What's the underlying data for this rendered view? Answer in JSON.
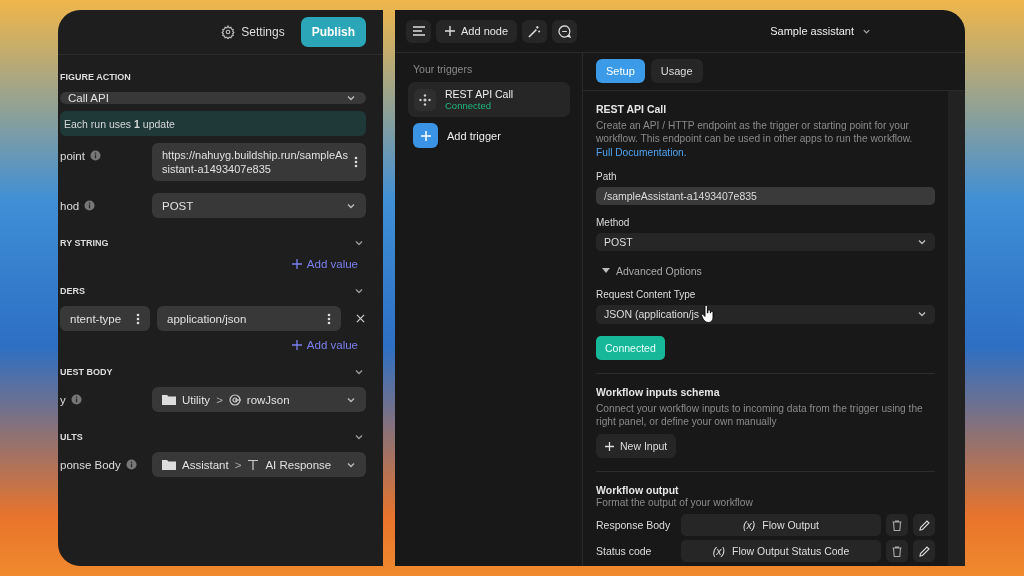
{
  "left_window": {
    "settings_label": "Settings",
    "publish_label": "Publish",
    "rows": [
      {
        "kind": "section",
        "label": "FIGURE ACTION",
        "expanded": null
      },
      {
        "kind": "select",
        "value": "Call API"
      },
      {
        "kind": "notice",
        "text": "Each run uses **1** update"
      },
      {
        "kind": "text-field",
        "label": "point",
        "value": "https://nahuyg.buildship.run/sampleAssistant-a1493407e835"
      },
      {
        "kind": "select-field",
        "label": "hod",
        "value": "POST"
      },
      {
        "kind": "section",
        "label": "RY STRING",
        "expanded": true
      },
      {
        "kind": "add",
        "label": "Add value"
      },
      {
        "kind": "section",
        "label": "DERS",
        "expanded": true
      },
      {
        "kind": "pair",
        "key": "ntent-type",
        "value": "application/json"
      },
      {
        "kind": "add",
        "label": "Add value"
      },
      {
        "kind": "section",
        "label": "UEST BODY",
        "expanded": true
      },
      {
        "kind": "path-field",
        "label": "y",
        "folder": "Utility",
        "separator": ">",
        "item": {
          "kind": "variable",
          "label": "rowJson"
        }
      },
      {
        "kind": "section",
        "label": "ULTS",
        "expanded": true
      },
      {
        "kind": "path-field",
        "label": "ponse Body",
        "folder": "Assistant",
        "separator": ">",
        "item": {
          "kind": "text",
          "label": "AI Response"
        }
      }
    ]
  },
  "right_window": {
    "toolbar": {
      "add_node_label": "Add node",
      "workflow_name": "Sample assistant"
    },
    "sidebar": {
      "heading": "Your triggers",
      "triggers": [
        {
          "name": "REST API Call",
          "status": "Connected",
          "selected": true
        }
      ],
      "add_label": "Add trigger"
    },
    "tabs": [
      {
        "label": "Setup",
        "selected": true
      },
      {
        "label": "Usage",
        "selected": false
      }
    ],
    "setup": {
      "title": "REST API Call",
      "description": "Create an API / HTTP endpoint as the trigger or starting point for your workflow. This endpoint can be used in other apps to run the workflow.",
      "link": "Full Documentation.",
      "path_label": "Path",
      "path_value": "/sampleAssistant-a1493407e835",
      "method_label": "Method",
      "method_value": "POST",
      "advanced": {
        "label": "Advanced Options",
        "expanded": true
      },
      "content_type_label": "Request Content Type",
      "content_type_value": "JSON (application/js",
      "status_button": "Connected"
    },
    "inputs": {
      "title": "Workflow inputs schema",
      "description": "Connect your workflow inputs to incoming data from the trigger using the right panel, or define your own manually",
      "button": "New Input"
    },
    "output": {
      "title": "Workflow output",
      "subtitle": "Format the output of your workflow",
      "rows": [
        {
          "label": "Response Body",
          "prefix": "(x)",
          "value": "Flow Output"
        },
        {
          "label": "Status code",
          "prefix": "(x)",
          "value": "Flow Output Status Code"
        }
      ]
    }
  }
}
